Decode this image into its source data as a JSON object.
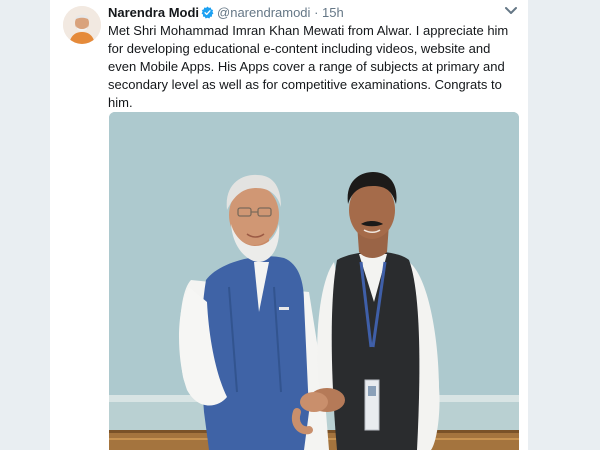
{
  "tweet": {
    "display_name": "Narendra Modi",
    "handle": "@narendramodi",
    "separator": "·",
    "time": "15h",
    "text": "Met Shri Mohammad Imran Khan Mewati from Alwar. I appreciate him for developing educational e-content including videos, website and even Mobile Apps. His Apps cover a range of subjects at primary and secondary level as well as for competitive examinations. Congrats to him.",
    "verified_icon": "verified-badge-icon",
    "menu_icon": "chevron-down-icon"
  },
  "colors": {
    "text": "#14171a",
    "secondary_text": "#657786",
    "verified": "#1da1f2",
    "page_bg": "#e9eef2"
  }
}
